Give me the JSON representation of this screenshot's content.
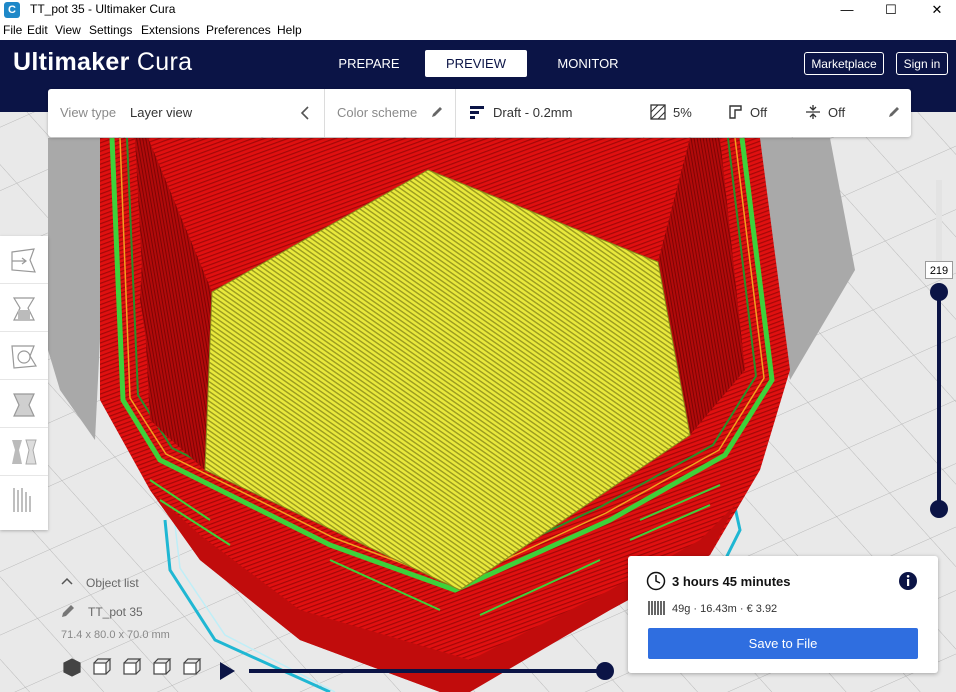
{
  "window": {
    "title": "TT_pot 35  - Ultimaker Cura",
    "app_icon": "C",
    "minimize": "—",
    "maximize": "☐",
    "close": "✕"
  },
  "menu": {
    "items": [
      "File",
      "Edit",
      "View",
      "Settings",
      "Extensions",
      "Preferences",
      "Help"
    ]
  },
  "header": {
    "logo_bold": "Ultimaker",
    "logo_light": " Cura",
    "tabs": [
      {
        "label": "PREPARE",
        "active": false
      },
      {
        "label": "PREVIEW",
        "active": true
      },
      {
        "label": "MONITOR",
        "active": false
      }
    ],
    "marketplace": "Marketplace",
    "sign_in": "Sign in"
  },
  "toolbar": {
    "view_type_label": "View type",
    "view_type_value": "Layer view",
    "color_scheme_label": "Color scheme",
    "profile": "Draft - 0.2mm",
    "infill": "5%",
    "support": "Off",
    "adhesion": "Off"
  },
  "tools": [
    "move-icon",
    "scale-icon",
    "rotate-icon",
    "mirror-icon",
    "per-model-settings-icon",
    "support-blocker-icon"
  ],
  "layer_slider": {
    "current_layer": "219",
    "upper_handle": 1.0,
    "lower_handle": 0.0
  },
  "object_list": {
    "toggle_label": "Object list",
    "object_name": "TT_pot 35",
    "dimensions": "71.4 x 80.0 x 70.0 mm"
  },
  "playback": {
    "progress": 1.0
  },
  "print_info": {
    "time": "3 hours 45 minutes",
    "details": "49g · 16.43m · € 3.92",
    "save_button": "Save to File"
  },
  "colors": {
    "header_bg": "#0b1446",
    "accent": "#2f6ee0",
    "wall_red": "#d80f0f",
    "infill_yellow": "#e8e83a",
    "skin_green": "#3ed13a"
  }
}
